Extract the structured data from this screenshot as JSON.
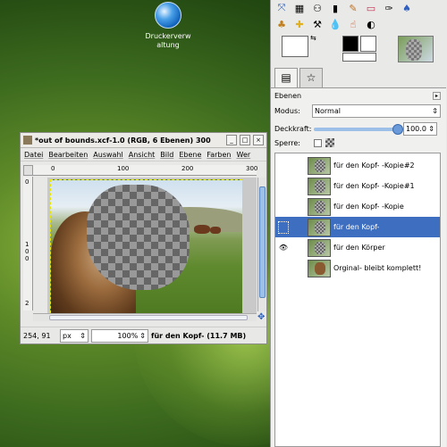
{
  "desktop": {
    "icon_label": "Druckerverw altung"
  },
  "image_window": {
    "title": "*out of bounds.xcf-1.0 (RGB, 6 Ebenen) 300",
    "menu": [
      "Datei",
      "Bearbeiten",
      "Auswahl",
      "Ansicht",
      "Bild",
      "Ebene",
      "Farben",
      "Wer"
    ],
    "ruler_h": [
      "0",
      "100",
      "200",
      "300"
    ],
    "ruler_v": [
      "0",
      "1",
      "0",
      "0",
      "2"
    ],
    "status": {
      "coords": "254, 91",
      "unit": "px",
      "zoom": "100%",
      "layer_info": "für den Kopf-  (11.7 MB)"
    }
  },
  "dock": {
    "layers_title": "Ebenen",
    "mode_label": "Modus:",
    "mode_value": "Normal",
    "opacity_label": "Deckkraft:",
    "opacity_value": "100.0",
    "opacity_level": 1.0,
    "lock_label": "Sperre:",
    "layers": [
      {
        "name": "für den Kopf- -Kopie#2",
        "visible": false,
        "selected": false
      },
      {
        "name": "für den Kopf- -Kopie#1",
        "visible": false,
        "selected": false
      },
      {
        "name": "für den Kopf- -Kopie",
        "visible": false,
        "selected": false
      },
      {
        "name": "für den Kopf-",
        "visible": false,
        "selected": true
      },
      {
        "name": "für den Körper",
        "visible": true,
        "selected": false
      },
      {
        "name": "Orginal- bleibt komplett!",
        "visible": false,
        "selected": false
      }
    ]
  },
  "colors": {
    "selection": "#3d6ec0",
    "scroll_thumb": "#9cc0e8"
  }
}
